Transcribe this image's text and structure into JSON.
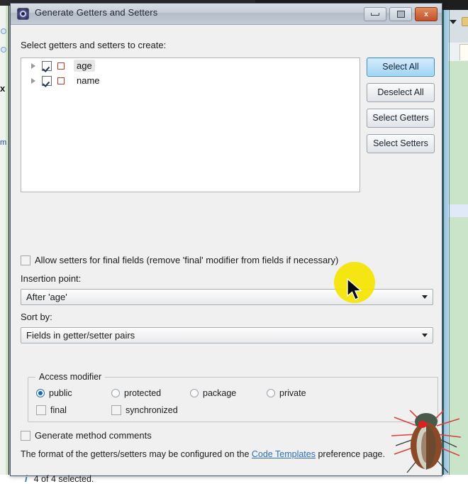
{
  "background": {
    "editor_left_mark": "x",
    "editor_left_text": "m"
  },
  "dialog": {
    "title": "Generate Getters and Setters",
    "icon": "eclipse-app-icon",
    "window_buttons": [
      {
        "name": "minimize-button",
        "label": ""
      },
      {
        "name": "maximize-button",
        "label": ""
      },
      {
        "name": "close-button",
        "label": "x"
      }
    ],
    "prompt": "Select getters and setters to create:",
    "tree": {
      "items": [
        {
          "label": "age",
          "checked": true,
          "expanded": false,
          "selected": true
        },
        {
          "label": "name",
          "checked": true,
          "expanded": false,
          "selected": false
        }
      ]
    },
    "side_buttons": [
      {
        "label": "Select All",
        "focused": true
      },
      {
        "label": "Deselect All",
        "focused": false
      },
      {
        "label": "Select Getters",
        "focused": false
      },
      {
        "label": "Select Setters",
        "focused": false
      }
    ],
    "allow_setters": {
      "label": "Allow setters for final fields (remove 'final' modifier from fields if necessary)",
      "checked": false
    },
    "insertion_point": {
      "label": "Insertion point:",
      "value": "After 'age'"
    },
    "sort_by": {
      "label": "Sort by:",
      "value": "Fields in getter/setter pairs"
    },
    "access_modifier": {
      "title": "Access modifier",
      "radios": [
        {
          "label": "public",
          "selected": true
        },
        {
          "label": "protected",
          "selected": false
        },
        {
          "label": "package",
          "selected": false
        },
        {
          "label": "private",
          "selected": false
        }
      ],
      "checkboxes": [
        {
          "label": "final",
          "checked": false
        },
        {
          "label": "synchronized",
          "checked": false
        }
      ]
    },
    "generate_comments": {
      "label": "Generate method comments",
      "checked": false
    },
    "hint": {
      "prefix": "The format of the getters/setters may be configured on the ",
      "link": "Code Templates",
      "suffix": " preference page."
    },
    "status": {
      "icon": "info-icon",
      "text": "4 of 4 selected."
    }
  },
  "overlay": {
    "click_highlight": "yellow-click-highlight",
    "cursor": "mouse-pointer",
    "bug_image": "insect-overlay"
  },
  "colors": {
    "accent": "#2f6fb4",
    "highlight": "#f5e400",
    "close": "#c3502a",
    "background_green": "#c9e4c9"
  }
}
